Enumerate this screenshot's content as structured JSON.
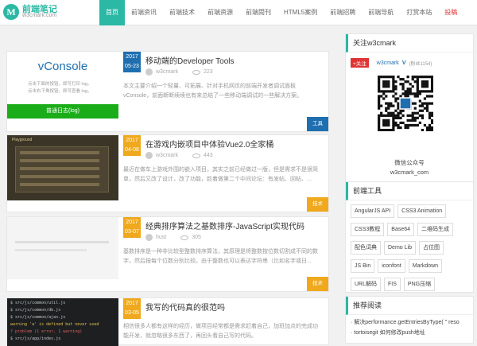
{
  "header": {
    "logo_mark": "M",
    "logo_name": "前端笔记",
    "logo_url": "w3cmark.com",
    "nav": [
      {
        "label": "首页",
        "style": "active"
      },
      {
        "label": "前端资讯",
        "style": ""
      },
      {
        "label": "前端技术",
        "style": ""
      },
      {
        "label": "前端资源",
        "style": ""
      },
      {
        "label": "前端閱刊",
        "style": ""
      },
      {
        "label": "HTML5案例",
        "style": ""
      },
      {
        "label": "前端招聘",
        "style": ""
      },
      {
        "label": "前端导航",
        "style": ""
      },
      {
        "label": "打赏本站",
        "style": ""
      },
      {
        "label": "投稿",
        "style": "red"
      }
    ]
  },
  "posts": [
    {
      "year": "2017",
      "date": "05-23",
      "title": "移动端的Developer Tools",
      "author": "w3cmark",
      "views": "223",
      "excerpt": "本文主要介绍一个轻量、可拓展、针对手机网页的前端开发者调试面板vConsole，前面断断续续也有来总结了一些移动端调试的一些解决方案。",
      "tag": "工具",
      "tag_color": "#1f6fb0",
      "date_color": "#1f6fb0",
      "thumb": {
        "title": "vConsole",
        "line1": "点击下面的按钮，即可打印 log。",
        "line2": "点击右下角按钮，即可查看 log。",
        "button": "普通日志(log)"
      }
    },
    {
      "year": "2017",
      "date": "04-08",
      "title": "在游戏内嵌项目中体验Vue2.0全家桶",
      "author": "w3cmark",
      "views": "443",
      "excerpt": "最近在做车上游戏外围的嵌入项目，其实之前已经做过一版，但是需求不是很简单，然后又改了设计，改了功能，趁着做第二个中间论坛：有发帖、回帖、...",
      "tag": "技术",
      "tag_color": "#f0a81c",
      "date_color": "#f0a81c",
      "thumb": {
        "title": "Playground"
      }
    },
    {
      "year": "2017",
      "date": "03-07",
      "title": "经典排序算法之基数排序-JavaScript实现代码",
      "author": "hust",
      "views": "305",
      "excerpt": "基数排序是一种非比较型整数排序算法，其原理是将整数按位数切割成不同的数字，然后按每个位数分别比较。由于整数也可以表达字符串（比如名字或日...",
      "tag": "技术",
      "tag_color": "#f0a81c",
      "date_color": "#f0a81c"
    },
    {
      "year": "2017",
      "date": "03-05",
      "title": "我写的代码真的很范吗",
      "author": "",
      "views": "",
      "excerpt": "相信很多人都有这样的经历，做项目经常都是需求赶着自己，加班加点的完成功能开发，就忽略很多东西了，再回头看自己写的代码。",
      "tag": "",
      "tag_color": "#f0a81c",
      "date_color": "#f0a81c",
      "thumb": {
        "lines": [
          "$ src/js/common/util.js",
          "$ src/js/common/db.js",
          "$ src/js/common/ajax.js",
          "warning 'a' is defined but never used",
          "? problem (1 error, 1 warning)",
          "$ src/js/app/index.js"
        ]
      }
    }
  ],
  "sidebar": {
    "follow": {
      "title": "关注w3cmark",
      "weibo_name": "w3cmark",
      "weibo_fans": "(粉丝1154)",
      "follow_label": "+关注",
      "qr_caption": "微信公众号",
      "qr_id": "w3cmark_com"
    },
    "tools": {
      "title": "前端工具",
      "items": [
        "AngularJS API",
        "CSS3 Animation",
        "CSS3教程",
        "Base64",
        "二维码生成",
        "配色词典",
        "Demo Lib",
        "占位图",
        "JS Bin",
        "iconfont",
        "Markdown",
        "URL解码",
        "FIS",
        "PNG压缩"
      ]
    },
    "reading": {
      "title": "推荐阅读",
      "items": [
        "· 解决performance.getEntriesByType( \" reso",
        "· tortoisegit 如何修改push地址"
      ]
    }
  }
}
